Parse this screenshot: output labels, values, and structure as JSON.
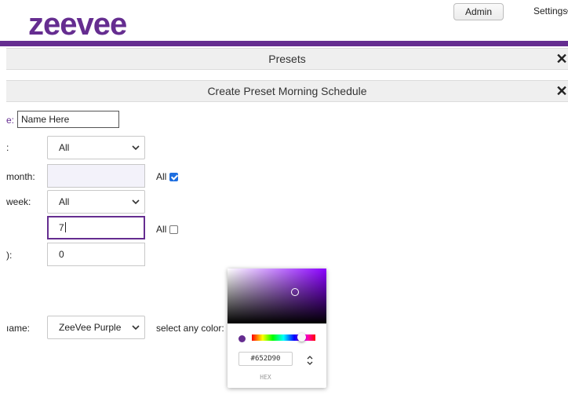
{
  "header": {
    "logo_text": "zeevee",
    "admin_label": "Admin",
    "settings_label": "Settings",
    "brand_color": "#652d90",
    "logo_color": "#652d90"
  },
  "panels": {
    "presets_title": "Presets",
    "create_title": "Create Preset Morning Schedule",
    "close_symbol": "✕"
  },
  "form": {
    "name_label": "e:",
    "name_value": "Name Here",
    "month_label": ":",
    "month_value": "All",
    "day_of_month_label": "month:",
    "day_of_month_all_label": "All",
    "day_of_month_all_checked": true,
    "day_of_week_label": "week:",
    "day_of_week_value": "All",
    "hour_value": "7",
    "hour_all_label": "All",
    "hour_all_checked": false,
    "minute_label": "):",
    "minute_value": "0",
    "color_name_label": "ıame:",
    "color_name_value": "ZeeVee Purple",
    "select_color_label": "select any color:"
  },
  "color_picker": {
    "hex_value": "#652D90",
    "format_label": "HEX",
    "current_color": "#652d90",
    "hue_fraction": 0.78
  }
}
